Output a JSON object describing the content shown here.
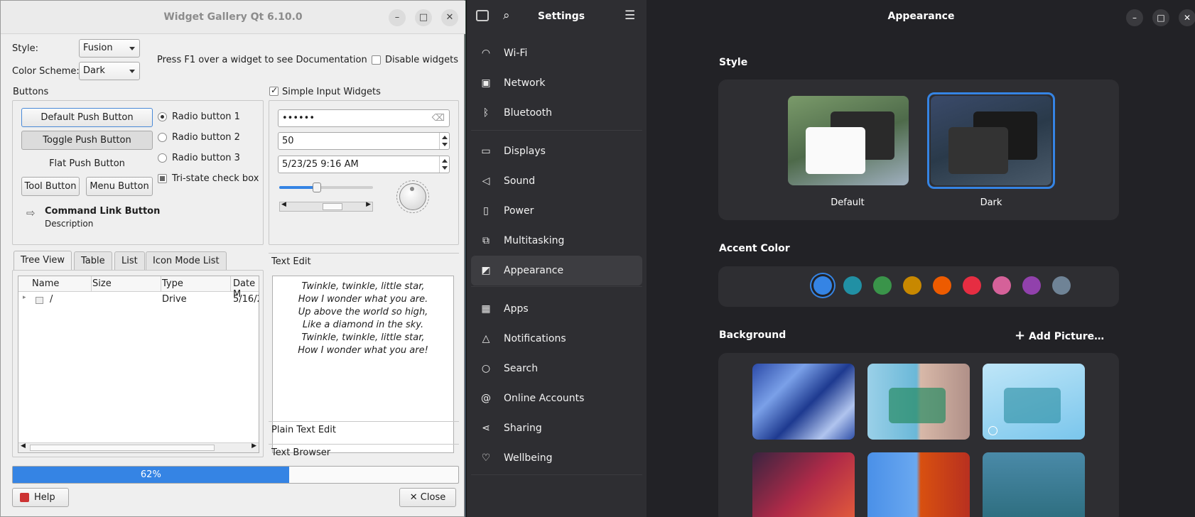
{
  "qt": {
    "title": "Widget Gallery Qt 6.10.0",
    "style_label": "Style:",
    "style_value": "Fusion",
    "scheme_label": "Color Scheme:",
    "scheme_value": "Dark",
    "help_text": "Press F1 over a widget to see Documentation",
    "disable_widgets": "Disable widgets",
    "buttons_group": "Buttons",
    "default_push": "Default Push Button",
    "toggle_push": "Toggle Push Button",
    "flat_push": "Flat Push Button",
    "tool_button": "Tool Button",
    "menu_button": "Menu Button",
    "cmd_link": "Command Link Button",
    "cmd_desc": "Description",
    "radio1": "Radio button 1",
    "radio2": "Radio button 2",
    "radio3": "Radio button 3",
    "tristate": "Tri-state check box",
    "simple_input": "Simple Input Widgets",
    "password": "••••••",
    "spin_value": "50",
    "datetime": "5/23/25 9:16 AM",
    "slider_fraction": 0.4,
    "tabs": [
      "Tree View",
      "Table",
      "List",
      "Icon Mode List"
    ],
    "tree_cols": [
      "Name",
      "Size",
      "Type",
      "Date M"
    ],
    "tree_row": {
      "name": "/",
      "size": "",
      "type": "Drive",
      "date": "5/16/2"
    },
    "text_edit": "Text Edit",
    "poem": [
      "Twinkle, twinkle, little star,",
      "How I wonder what you are.",
      "Up above the world so high,",
      "Like a diamond in the sky.",
      "Twinkle, twinkle, little star,",
      "How I wonder what you are!"
    ],
    "plain_text_edit": "Plain Text Edit",
    "text_browser": "Text Browser",
    "progress": 62,
    "progress_label": "62%",
    "help_btn": "Help",
    "close_btn": "Close"
  },
  "settings": {
    "title": "Settings",
    "page_title": "Appearance",
    "nav": [
      {
        "label": "Wi-Fi",
        "icon": "wifi-icon",
        "glyph": "◠"
      },
      {
        "label": "Network",
        "icon": "network-icon",
        "glyph": "▣"
      },
      {
        "label": "Bluetooth",
        "icon": "bluetooth-icon",
        "glyph": "ᛒ"
      },
      {
        "label": "Displays",
        "icon": "display-icon",
        "glyph": "▭"
      },
      {
        "label": "Sound",
        "icon": "sound-icon",
        "glyph": "◁"
      },
      {
        "label": "Power",
        "icon": "power-icon",
        "glyph": "▯"
      },
      {
        "label": "Multitasking",
        "icon": "multitasking-icon",
        "glyph": "⧉"
      },
      {
        "label": "Appearance",
        "icon": "appearance-icon",
        "glyph": "◩"
      },
      {
        "label": "Apps",
        "icon": "apps-icon",
        "glyph": "▦"
      },
      {
        "label": "Notifications",
        "icon": "bell-icon",
        "glyph": "△"
      },
      {
        "label": "Search",
        "icon": "search-icon",
        "glyph": "○"
      },
      {
        "label": "Online Accounts",
        "icon": "at-icon",
        "glyph": "@"
      },
      {
        "label": "Sharing",
        "icon": "share-icon",
        "glyph": "⋖"
      },
      {
        "label": "Wellbeing",
        "icon": "wellbeing-icon",
        "glyph": "♡"
      }
    ],
    "style_heading": "Style",
    "style_default": "Default",
    "style_dark": "Dark",
    "accent_heading": "Accent Color",
    "accent_colors": [
      "#3584e4",
      "#2190a4",
      "#3a944a",
      "#c88800",
      "#ed5b00",
      "#e62d42",
      "#d56199",
      "#9141ac",
      "#6f8396"
    ],
    "background_heading": "Background",
    "add_picture": "Add Picture…"
  }
}
